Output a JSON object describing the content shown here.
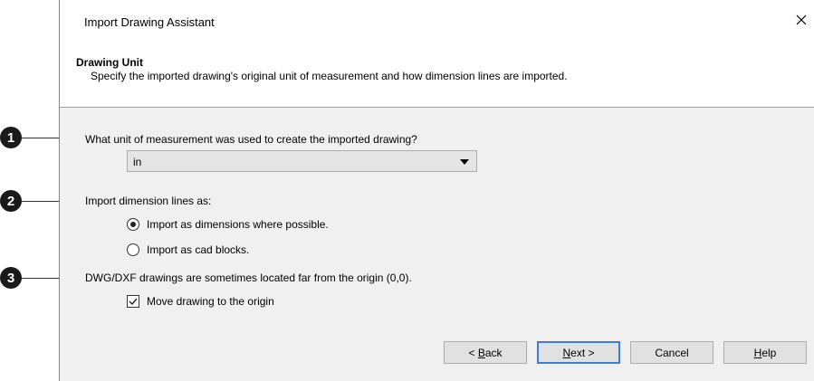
{
  "window": {
    "title": "Import Drawing Assistant",
    "close_glyph": "✕"
  },
  "header": {
    "title": "Drawing Unit",
    "description": "Specify the imported drawing's original unit of measurement and how dimension lines are imported."
  },
  "unit": {
    "question": "What unit of measurement was used to create the imported drawing?",
    "selected": "in"
  },
  "dimension": {
    "label": "Import dimension lines as:",
    "options": [
      {
        "label": "Import as dimensions where possible.",
        "checked": true
      },
      {
        "label": "Import as cad blocks.",
        "checked": false
      }
    ]
  },
  "origin": {
    "note": "DWG/DXF drawings are sometimes located far from the origin (0,0).",
    "checkbox_label": "Move drawing to the origin",
    "checked": true
  },
  "buttons": {
    "back_prefix": "< ",
    "back_mnemonic": "B",
    "back_rest": "ack",
    "next_mnemonic": "N",
    "next_rest": "ext >",
    "cancel": "Cancel",
    "help_mnemonic": "H",
    "help_rest": "elp"
  },
  "callouts": [
    "1",
    "2",
    "3"
  ]
}
